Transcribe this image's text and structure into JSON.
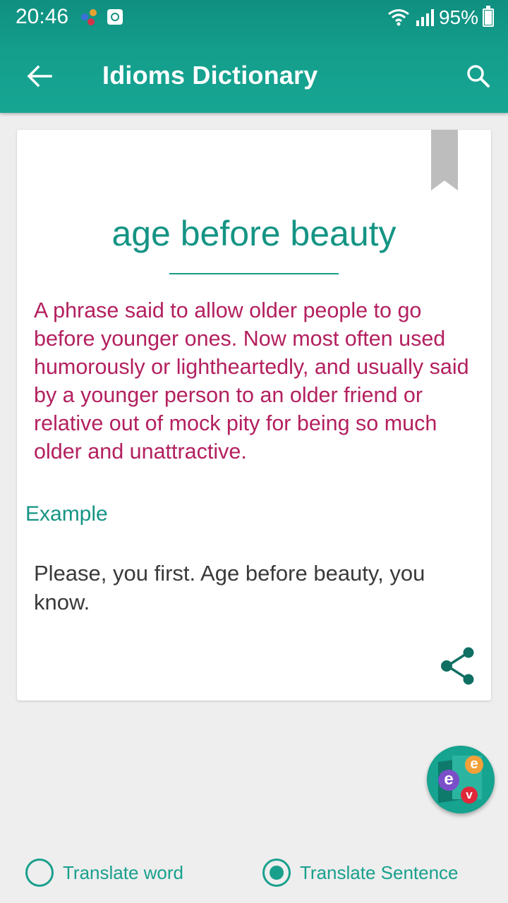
{
  "status_bar": {
    "time": "20:46",
    "battery": "95%"
  },
  "app_bar": {
    "title": "Idioms Dictionary",
    "back_icon": "arrow-left-icon",
    "search_icon": "search-icon"
  },
  "card": {
    "idiom": "age before beauty",
    "definition": "A phrase said to allow older people to go before younger ones. Now most often used humorously or lightheartedly, and usually said by a younger person to an older friend or relative out of mock pity for being so much older and unattractive.",
    "example_label": "Example",
    "example_text": "Please, you first. Age before beauty, you know.",
    "bookmark_icon": "bookmark-icon",
    "share_icon": "share-icon"
  },
  "fab": {
    "badge_e1": "e",
    "badge_e2": "e",
    "badge_v": "v"
  },
  "translate_options": [
    {
      "label": "Translate word",
      "selected": false
    },
    {
      "label": "Translate Sentence",
      "selected": true
    }
  ],
  "colors": {
    "primary": "#149e8c",
    "accent_title": "#159484",
    "definition_text": "#b3205f",
    "background": "#eeeeee"
  }
}
